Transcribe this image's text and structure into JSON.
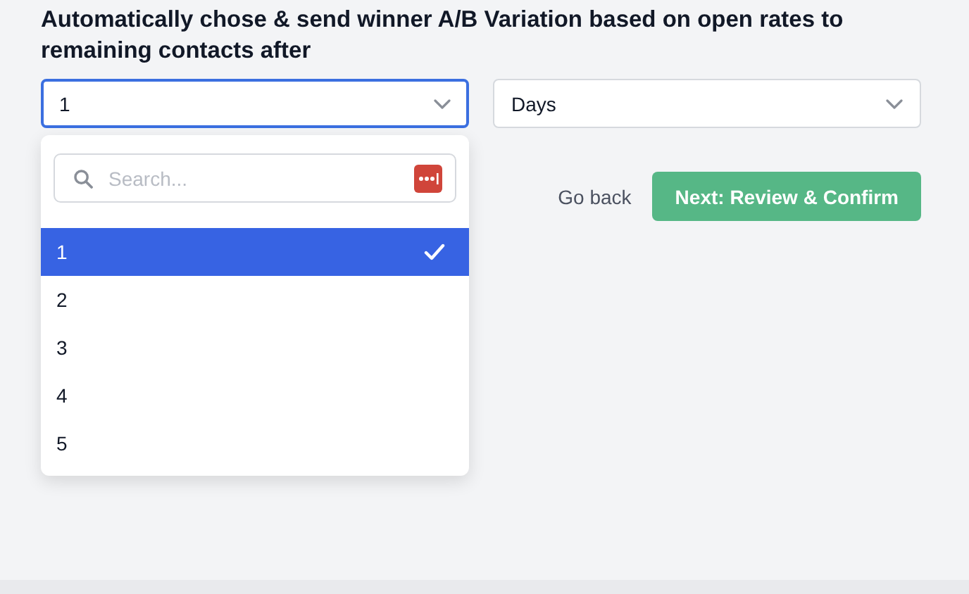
{
  "heading": "Automatically chose & send winner A/B Variation based on open rates to remaining contacts after",
  "amount_select": {
    "value": "1",
    "open": true
  },
  "unit_select": {
    "value": "Days",
    "open": false
  },
  "dropdown": {
    "search": {
      "placeholder": "Search..."
    },
    "options": [
      {
        "label": "1",
        "selected": true
      },
      {
        "label": "2",
        "selected": false
      },
      {
        "label": "3",
        "selected": false
      },
      {
        "label": "4",
        "selected": false
      },
      {
        "label": "5",
        "selected": false
      }
    ]
  },
  "buttons": {
    "back": "Go back",
    "next": "Next: Review & Confirm"
  }
}
